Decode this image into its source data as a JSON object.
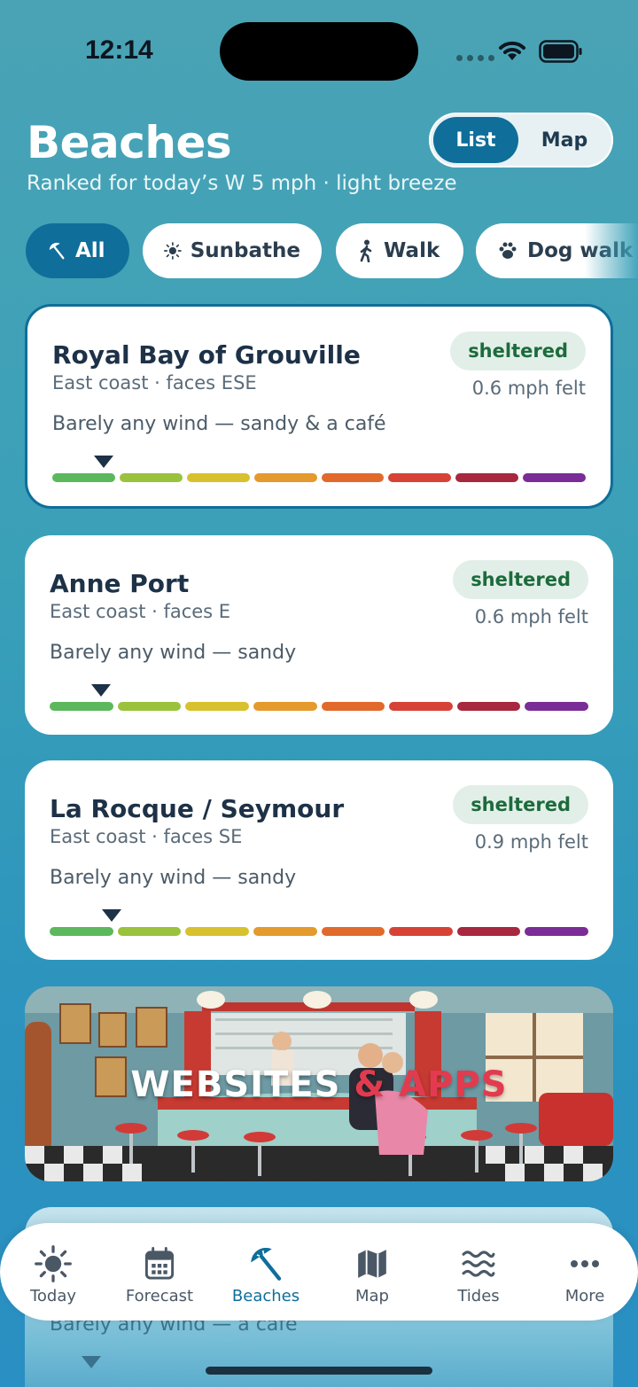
{
  "status_bar": {
    "time": "12:14"
  },
  "header": {
    "title": "Beaches",
    "subtitle": "Ranked for today’s W 5 mph · light breeze",
    "view_toggle": {
      "list_label": "List",
      "map_label": "Map",
      "selected": "List"
    }
  },
  "filters": [
    {
      "label": "All",
      "icon": "beach-umbrella-icon",
      "active": true
    },
    {
      "label": "Sunbathe",
      "icon": "sun-icon",
      "active": false
    },
    {
      "label": "Walk",
      "icon": "walking-person-icon",
      "active": false
    },
    {
      "label": "Dog walk",
      "icon": "paw-icon",
      "active": false
    }
  ],
  "wind_scale_colors": [
    "#5cb85c",
    "#9bc23c",
    "#d8c12e",
    "#e49a2d",
    "#e2692c",
    "#d64336",
    "#a8283f",
    "#7a2d96"
  ],
  "beaches": [
    {
      "name": "Royal Bay of Grouville",
      "location": "East coast · faces ESE",
      "description": "Barely any wind — sandy & a café",
      "badge": "sheltered",
      "felt": "0.6 mph felt",
      "wind_felt_mph": 0.6,
      "selected": true
    },
    {
      "name": "Anne Port",
      "location": "East coast · faces E",
      "description": "Barely any wind — sandy",
      "badge": "sheltered",
      "felt": "0.6 mph felt",
      "wind_felt_mph": 0.6,
      "selected": false
    },
    {
      "name": "La Rocque / Seymour",
      "location": "East coast · faces SE",
      "description": "Barely any wind — sandy",
      "badge": "sheltered",
      "felt": "0.9 mph felt",
      "wind_felt_mph": 0.9,
      "selected": false
    }
  ],
  "banner": {
    "text_white": "WEBSITES",
    "text_red": "& APPS"
  },
  "partial_card": {
    "description": "Barely any wind — a café"
  },
  "tabs": [
    {
      "label": "Today",
      "icon": "sun-icon",
      "active": false
    },
    {
      "label": "Forecast",
      "icon": "calendar-icon",
      "active": false
    },
    {
      "label": "Beaches",
      "icon": "beach-umbrella-icon",
      "active": true
    },
    {
      "label": "Map",
      "icon": "map-icon",
      "active": false
    },
    {
      "label": "Tides",
      "icon": "waves-icon",
      "active": false
    },
    {
      "label": "More",
      "icon": "more-dots-icon",
      "active": false
    }
  ]
}
